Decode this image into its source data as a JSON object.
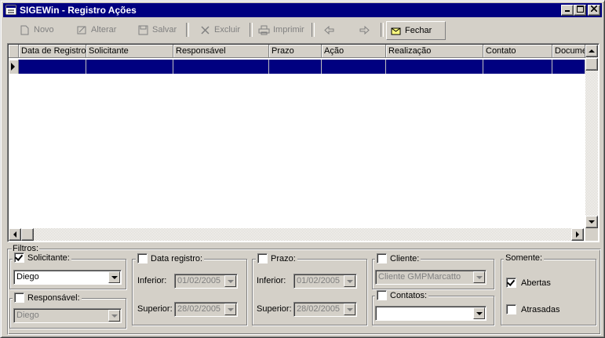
{
  "window": {
    "title": "SIGEWin - Registro Ações"
  },
  "toolbar": {
    "novo": "Novo",
    "alterar": "Alterar",
    "salvar": "Salvar",
    "excluir": "Excluir",
    "imprimir": "Imprimir",
    "fechar": "Fechar"
  },
  "grid": {
    "columns": [
      "Data de Registro",
      "Solicitante",
      "Responsável",
      "Prazo",
      "Ação",
      "Realização",
      "Contato",
      "Docume"
    ]
  },
  "filters": {
    "label": "Filtros:",
    "solicitante": {
      "label": "Solicitante:",
      "checked": true,
      "value": "Diego"
    },
    "responsavel": {
      "label": "Responsável:",
      "checked": false,
      "value": "Diego"
    },
    "data_registro": {
      "label": "Data registro:",
      "inferior_label": "Inferior:",
      "inferior": "01/02/2005",
      "superior_label": "Superior:",
      "superior": "28/02/2005"
    },
    "prazo": {
      "label": "Prazo:",
      "inferior_label": "Inferior:",
      "inferior": "01/02/2005",
      "superior_label": "Superior:",
      "superior": "28/02/2005"
    },
    "cliente": {
      "label": "Cliente:",
      "value": "Cliente GMPMarcatto"
    },
    "contatos": {
      "label": "Contatos:",
      "value": ""
    },
    "somente": {
      "label": "Somente:",
      "abertas": "Abertas",
      "atrasadas": "Atrasadas"
    }
  }
}
